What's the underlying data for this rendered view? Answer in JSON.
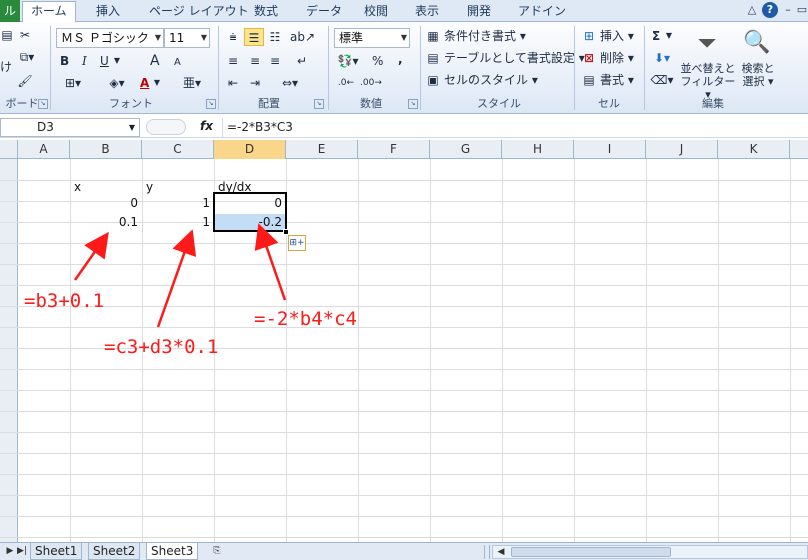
{
  "tabs": [
    "ル",
    "ホーム",
    "挿入",
    "ページ レイアウト",
    "数式",
    "データ",
    "校閲",
    "表示",
    "開発",
    "アドイン"
  ],
  "ribbon": {
    "clipboard": {
      "label": "ボード",
      "paste_label": "け"
    },
    "font": {
      "label": "フォント",
      "font_name": "ＭＳ Ｐゴシック",
      "font_size": "11",
      "bold": "B",
      "italic": "I",
      "underline": "U",
      "grow": "A",
      "shrink": "A",
      "font_color": "A"
    },
    "alignment": {
      "label": "配置"
    },
    "number": {
      "label": "数値",
      "format": "標準",
      "percent": "%",
      "comma": ","
    },
    "styles": {
      "label": "スタイル",
      "conditional": "条件付き書式",
      "as_table": "テーブルとして書式設定",
      "cell_styles": "セルのスタイル"
    },
    "cells": {
      "label": "セル",
      "insert": "挿入",
      "delete": "削除",
      "format": "書式"
    },
    "editing": {
      "label": "編集",
      "sigma": "Σ",
      "sort_filter_1": "並べ替えと",
      "sort_filter_2": "フィルター",
      "find_select_1": "検索と",
      "find_select_2": "選択"
    }
  },
  "formula_bar": {
    "name_box": "D3",
    "fx": "fx",
    "formula": "=-2*B3*C3"
  },
  "columns": [
    "A",
    "B",
    "C",
    "D",
    "E",
    "F",
    "G",
    "H",
    "I",
    "J",
    "K"
  ],
  "cells": {
    "b2": "x",
    "c2": "y",
    "d2": "dy/dx",
    "b3": "0",
    "c3": "1",
    "d3": "0",
    "b4": "0.1",
    "c4": "1",
    "d4": "-0.2"
  },
  "annotations": {
    "b_formula": "=b3+0.1",
    "c_formula": "=c3+d3*0.1",
    "d_formula": "=-2*b4*c4"
  },
  "sheets": [
    "Sheet1",
    "Sheet2",
    "Sheet3"
  ],
  "colors": {
    "annotation": "#ff1a1a",
    "selection": "#c5dcf7",
    "file_tab": "#2a8a3c"
  }
}
